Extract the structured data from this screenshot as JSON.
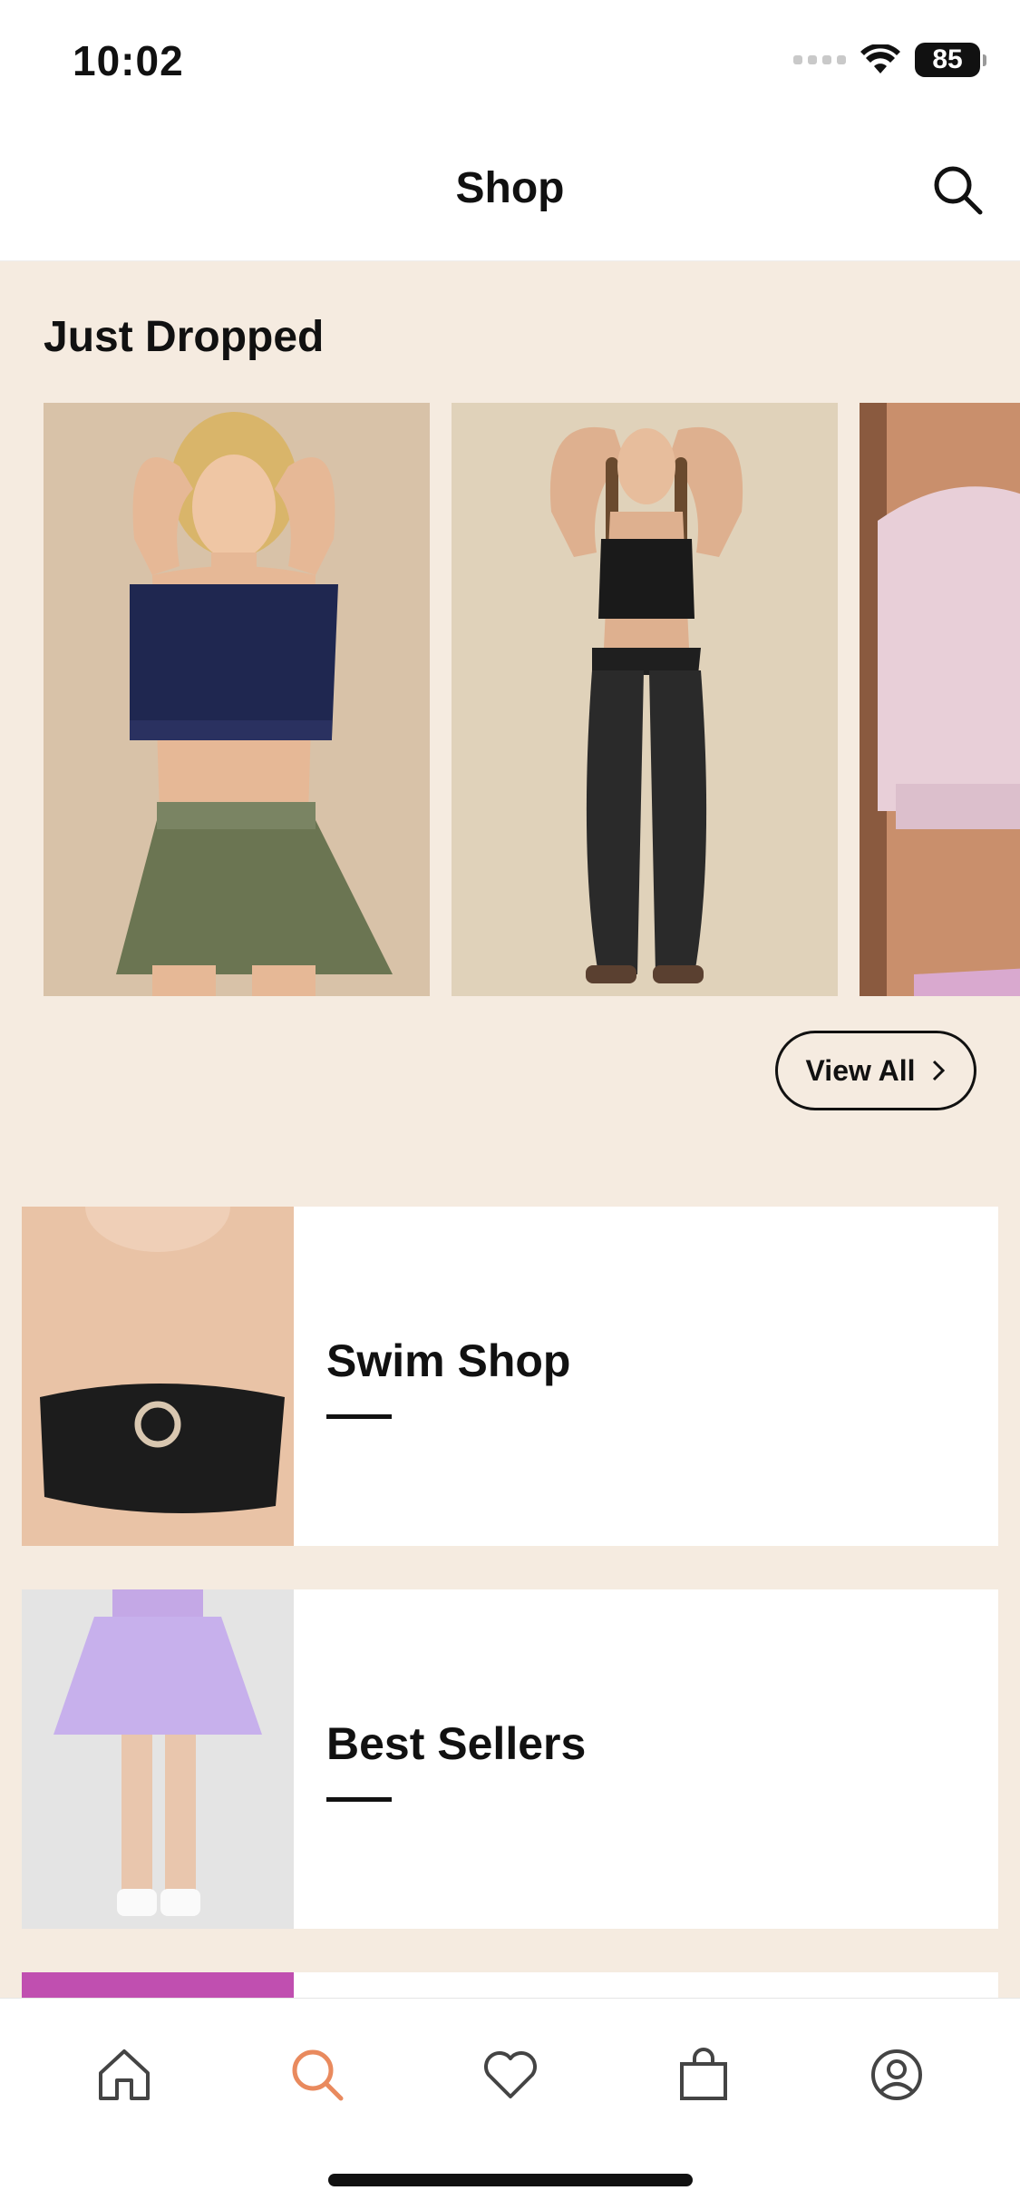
{
  "status_bar": {
    "time": "10:02",
    "battery": "85"
  },
  "header": {
    "title": "Shop",
    "search_icon": "search-icon"
  },
  "just_dropped": {
    "title": "Just Dropped",
    "products": [
      {
        "name": "navy-sports-bra-olive-skirt",
        "bg": "#d8c2a8"
      },
      {
        "name": "black-crop-top-flared-leggings",
        "bg": "#e0d2ba"
      },
      {
        "name": "lilac-sports-bra",
        "bg": "#d9c3ad"
      }
    ],
    "view_all_label": "View All"
  },
  "categories": [
    {
      "label": "Swim Shop"
    },
    {
      "label": "Best Sellers"
    }
  ],
  "tab_bar": {
    "tabs": [
      "home-icon",
      "search-icon",
      "heart-icon",
      "shopping-bag-icon",
      "profile-icon"
    ],
    "active": "search-icon",
    "active_color": "#e98a5e"
  },
  "colors": {
    "page_bg": "#f5ebe0",
    "accent": "#e98a5e",
    "text": "#111111"
  }
}
